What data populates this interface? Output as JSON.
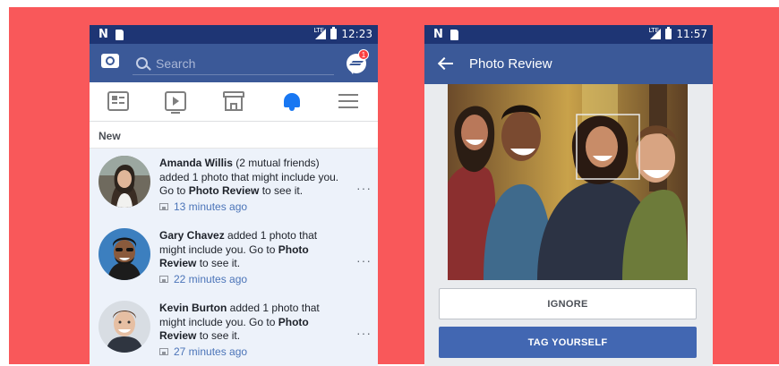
{
  "left_phone": {
    "status": {
      "carrier_glyph": "N",
      "network": "LTE",
      "time": "12:23"
    },
    "search": {
      "placeholder": "Search"
    },
    "messenger_badge": "1",
    "tabs": [
      "news-feed",
      "watch",
      "marketplace",
      "notifications",
      "menu"
    ],
    "active_tab": "notifications",
    "section_label": "New",
    "notifications": [
      {
        "name": "Amanda Willis",
        "pre": " (2 mutual friends) added 1 photo that might include you. Go to ",
        "link": "Photo Review",
        "post": " to see it.",
        "time": "13 minutes ago"
      },
      {
        "name": "Gary Chavez",
        "pre": " added 1 photo that might include you. Go to ",
        "link": "Photo Review",
        "post": " to see it.",
        "time": "22 minutes ago"
      },
      {
        "name": "Kevin Burton",
        "pre": " added 1 photo that might include you. Go to ",
        "link": "Photo Review",
        "post": " to see it.",
        "time": "27 minutes ago"
      }
    ],
    "more_glyph": "···"
  },
  "right_phone": {
    "status": {
      "carrier_glyph": "N",
      "network": "LTE",
      "time": "11:57"
    },
    "title": "Photo Review",
    "ignore_label": "IGNORE",
    "tag_label": "TAG YOURSELF"
  },
  "colors": {
    "background": "#f9585a",
    "facebook_blue": "#3b5998",
    "status_bar": "#1e3574",
    "tag_button": "#4267b2",
    "bell_active": "#1877f2"
  }
}
